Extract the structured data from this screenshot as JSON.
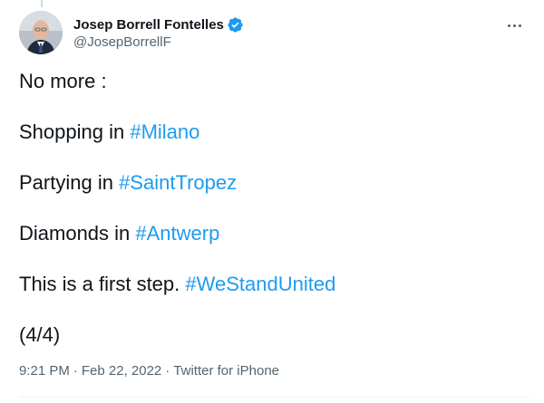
{
  "author": {
    "display_name": "Josep Borrell Fontelles",
    "handle": "@JosepBorrellF",
    "verified": true
  },
  "icons": {
    "verified": "verified-badge-icon",
    "more": "more-options-icon"
  },
  "colors": {
    "hashtag": "#1d9bf0",
    "text": "#0f1419",
    "muted": "#536471",
    "verified": "#1d9bf0"
  },
  "tweet": {
    "lines": [
      {
        "text": "No more :",
        "tag": ""
      },
      {
        "text": "Shopping in ",
        "tag": "#Milano"
      },
      {
        "text": "Partying in ",
        "tag": "#SaintTropez"
      },
      {
        "text": "Diamonds in ",
        "tag": "#Antwerp"
      },
      {
        "text": "This is a first step. ",
        "tag": "#WeStandUnited"
      },
      {
        "text": "(4/4)",
        "tag": ""
      }
    ]
  },
  "meta": {
    "time": "9:21 PM",
    "date": "Feb 22, 2022",
    "source": "Twitter for iPhone",
    "separator": "·"
  }
}
